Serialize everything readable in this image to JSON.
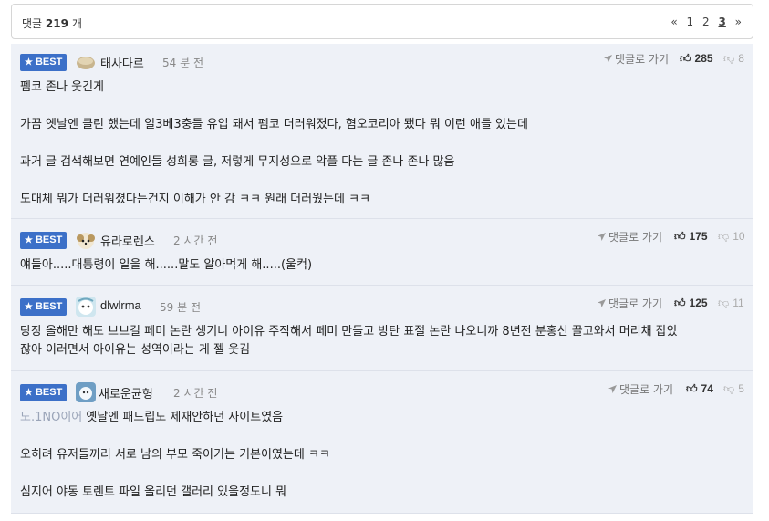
{
  "header": {
    "count_prefix": "댓글",
    "count_value": "219",
    "count_suffix": "개",
    "pager": {
      "first": "«",
      "pages": [
        "1",
        "2",
        "3"
      ],
      "current": "3",
      "last": "»"
    }
  },
  "common": {
    "badge_label": "BEST",
    "goto_label": "댓글로 가기"
  },
  "comments": [
    {
      "nick": "태사다르",
      "time": "54 분 전",
      "likes": "285",
      "dislikes": "8",
      "lines": [
        "펨코 존나 웃긴게",
        "가끔 옛날엔 클린 했는데 일3베3충들 유입 돼서 펨코 더러워졌다, 혐오코리아 됐다 뭐 이런 애들 있는데",
        "과거 글 검색해보면 연예인들 성희롱 글, 저렇게 무지성으로 악플 다는 글 존나 존나 많음",
        "도대체 뭐가 더러워졌다는건지 이해가 안 감 ㅋㅋ 원래 더러웠는데 ㅋㅋ"
      ]
    },
    {
      "nick": "유라로렌스",
      "time": "2 시간 전",
      "likes": "175",
      "dislikes": "10",
      "lines": [
        "얘들아.....대통령이 일을 해......말도 알아먹게 해.....(울컥)"
      ]
    },
    {
      "nick": "dlwlrma",
      "time": "59 분 전",
      "likes": "125",
      "dislikes": "11",
      "lines": [
        "당장 올해만 해도 브브걸 페미 논란 생기니 아이유 주작해서 페미 만들고 방탄 표절 논란 나오니까 8년전 분홍신 끌고와서 머리채 잡았",
        "잖아 이러면서 아이유는 성역이라는 게 젤 웃김"
      ]
    },
    {
      "nick": "새로운균형",
      "time": "2 시간 전",
      "likes": "74",
      "dislikes": "5",
      "ref_nick": "노.1NO이어",
      "lines": [
        "옛날엔 패드립도 제재안하던 사이트였음",
        "오히려 유저들끼리 서로 남의 부모 죽이기는 기본이였는데 ㅋㅋ",
        "심지어 야동 토렌트 파일 올리던 갤러리 있을정도니 뭐"
      ]
    }
  ]
}
